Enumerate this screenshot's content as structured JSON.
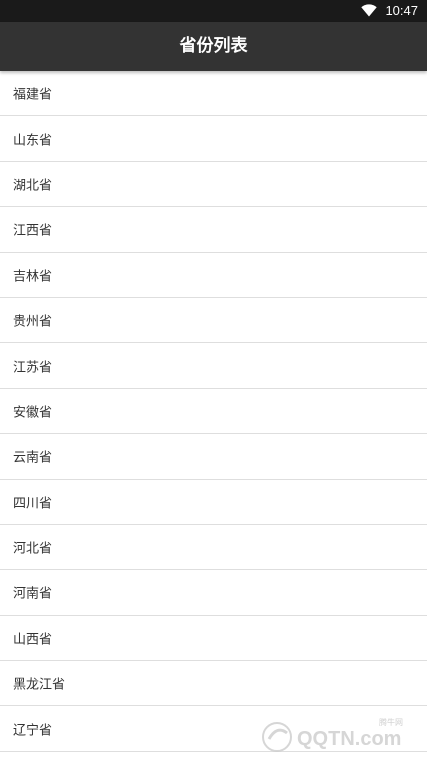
{
  "status_bar": {
    "time": "10:47",
    "wifi_icon": "wifi-icon"
  },
  "app_bar": {
    "title": "省份列表"
  },
  "provinces": [
    "福建省",
    "山东省",
    "湖北省",
    "江西省",
    "吉林省",
    "贵州省",
    "江苏省",
    "安徽省",
    "云南省",
    "四川省",
    "河北省",
    "河南省",
    "山西省",
    "黑龙江省",
    "辽宁省"
  ],
  "watermark": {
    "brand": "QQTN.com",
    "tagline": "腾牛网"
  },
  "colors": {
    "status_bar": "#1a1a1a",
    "app_bar": "#333333",
    "divider": "#dedede",
    "text": "#333333"
  }
}
